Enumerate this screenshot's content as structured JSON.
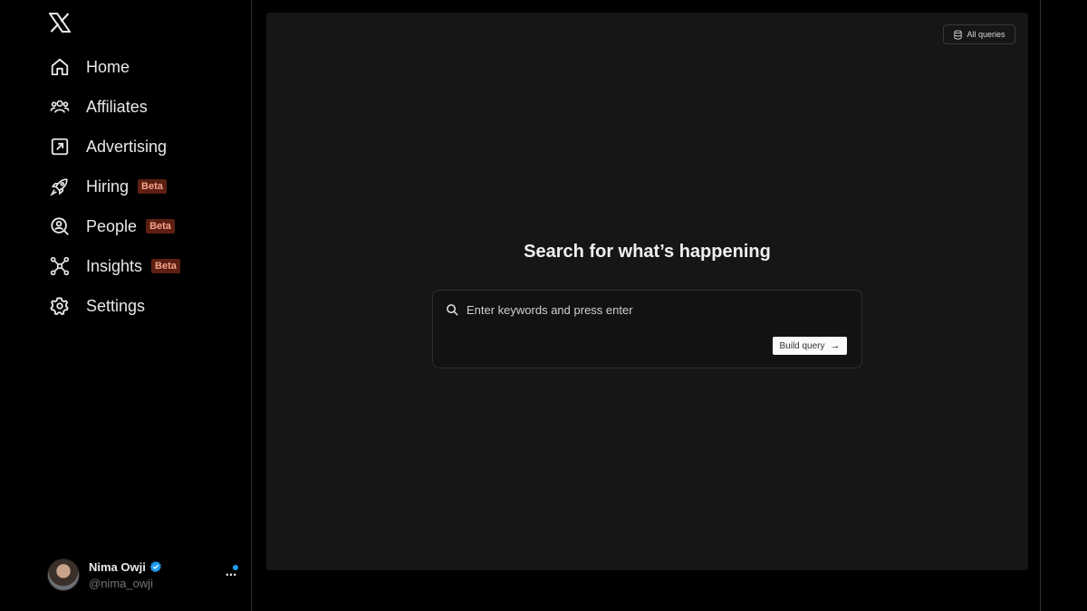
{
  "sidebar": {
    "logo": "x-logo-icon",
    "items": [
      {
        "label": "Home",
        "icon": "home-icon"
      },
      {
        "label": "Affiliates",
        "icon": "affiliates-icon"
      },
      {
        "label": "Advertising",
        "icon": "advertising-icon"
      },
      {
        "label": "Hiring",
        "icon": "rocket-icon",
        "badge": "Beta"
      },
      {
        "label": "People",
        "icon": "people-search-icon",
        "badge": "Beta"
      },
      {
        "label": "Insights",
        "icon": "network-icon",
        "badge": "Beta"
      },
      {
        "label": "Settings",
        "icon": "gear-icon"
      }
    ],
    "account": {
      "name": "Nima Owji",
      "handle": "@nima_owji",
      "verified": true,
      "more_label": "..."
    }
  },
  "main": {
    "all_queries_label": "All queries",
    "heading": "Search for what’s happening",
    "search": {
      "placeholder": "Enter keywords and press enter",
      "value": ""
    },
    "build_query_label": "Build query",
    "build_query_arrow": "→"
  },
  "colors": {
    "background": "#000000",
    "panel": "#161616",
    "beta_bg": "#5c1f12",
    "beta_text": "#f4a38a",
    "verified": "#1d9bf0",
    "notification_dot": "#1d9bf0"
  }
}
